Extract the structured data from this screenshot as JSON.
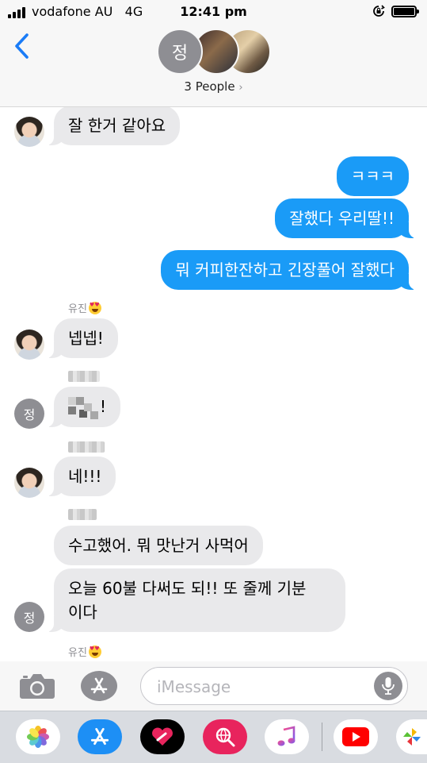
{
  "status_bar": {
    "carrier": "vodafone AU",
    "network": "4G",
    "time": "12:41 pm"
  },
  "header": {
    "group_avatar_initial": "정",
    "people_label": "3 People",
    "people_chevron": "›"
  },
  "messages": [
    {
      "direction": "in",
      "avatar": "photo",
      "text": "잘 한거 같아요"
    },
    {
      "direction": "out",
      "text": "ㅋㅋㅋ"
    },
    {
      "direction": "out",
      "text": "잘했다 우리딸!!"
    },
    {
      "direction": "out",
      "text": "뭐 커피한잔하고 긴장풀어 잘했다"
    },
    {
      "direction": "in",
      "sender": "유진",
      "avatar": "photo",
      "text": "넵넵!"
    },
    {
      "direction": "in",
      "avatar": "initial",
      "avatar_initial": "정",
      "text": "!"
    },
    {
      "direction": "in",
      "avatar": "photo",
      "text": "네!!!"
    },
    {
      "direction": "in",
      "text": "수고했어. 뭐 맛난거 사먹어"
    },
    {
      "direction": "in",
      "avatar": "initial",
      "avatar_initial": "정",
      "text_line1": "오늘 60불 다써도 되!! 또 줄께 기분",
      "text_line2": "이다"
    },
    {
      "sender": "유진"
    }
  ],
  "input": {
    "placeholder": "iMessage"
  },
  "icons": {
    "back": "chevron-left-icon",
    "camera": "camera-icon",
    "app_store": "app-store-icon",
    "mic": "microphone-icon",
    "emoji": "heart-eyes-emoji-icon"
  },
  "app_drawer": [
    "photos-app-icon",
    "app-store-app-icon",
    "digital-touch-app-icon",
    "web-images-app-icon",
    "music-app-icon",
    "youtube-app-icon",
    "photos-pinwheel-app-icon"
  ],
  "colors": {
    "outgoing_bubble": "#1a9bf7",
    "incoming_bubble": "#e9e9eb",
    "accent": "#1a7cf7"
  }
}
